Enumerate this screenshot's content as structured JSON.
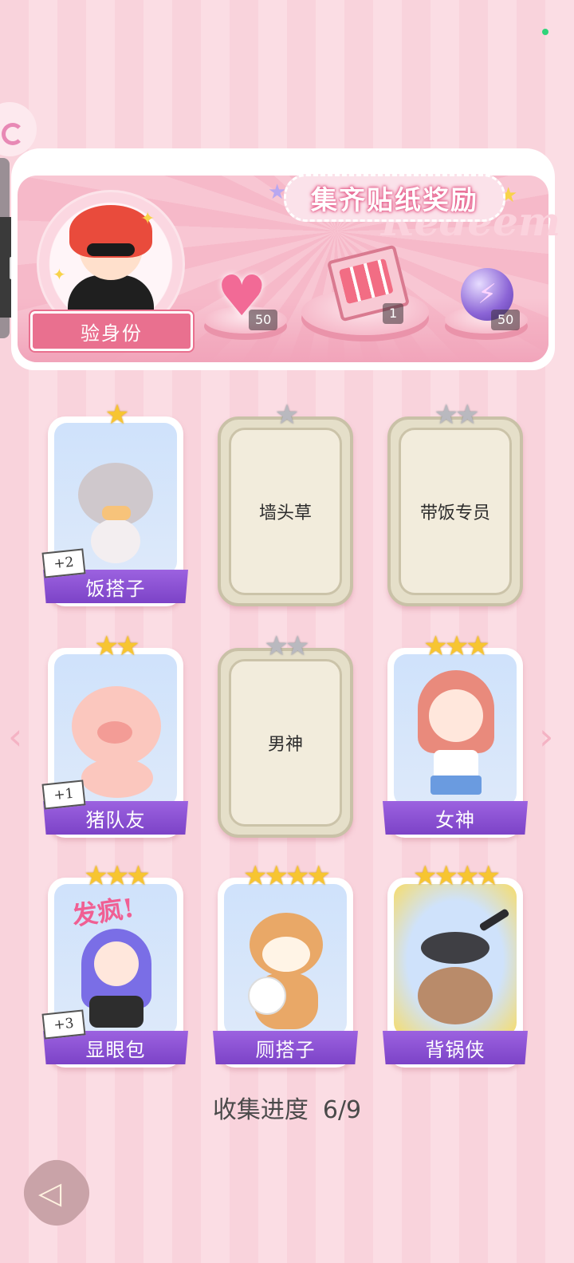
{
  "banner": {
    "title": "集齐贴纸奖励",
    "deco_text": "Redeem",
    "verify_label": "验身份",
    "rewards": [
      {
        "icon": "heart-gem-icon",
        "count": "50"
      },
      {
        "icon": "gift-box-icon",
        "count": "1"
      },
      {
        "icon": "energy-orb-icon",
        "count": "50"
      }
    ]
  },
  "cards": [
    {
      "label": "饭搭子",
      "stars": 1,
      "star_color": "gold",
      "locked": false,
      "plus": "+2",
      "art": "cat-with-cake"
    },
    {
      "label": "墙头草",
      "stars": 1,
      "star_color": "silver",
      "locked": true,
      "plus": "",
      "art": ""
    },
    {
      "label": "带饭专员",
      "stars": 2,
      "star_color": "silver",
      "locked": true,
      "plus": "",
      "art": ""
    },
    {
      "label": "猪队友",
      "stars": 2,
      "star_color": "gold",
      "locked": false,
      "plus": "+1",
      "art": "winking-pig"
    },
    {
      "label": "男神",
      "stars": 2,
      "star_color": "silver",
      "locked": true,
      "plus": "",
      "art": ""
    },
    {
      "label": "女神",
      "stars": 3,
      "star_color": "gold",
      "locked": false,
      "plus": "",
      "art": "schoolgirl"
    },
    {
      "label": "显眼包",
      "stars": 3,
      "star_color": "gold",
      "locked": false,
      "plus": "+3",
      "art": "crazy-girl",
      "art_text": "发疯!"
    },
    {
      "label": "厕搭子",
      "stars": 4,
      "star_color": "gold",
      "locked": false,
      "plus": "",
      "art": "shiba-toilet-paper"
    },
    {
      "label": "背锅侠",
      "stars": 4,
      "star_color": "gold",
      "locked": false,
      "plus": "",
      "art": "capybara-with-pan"
    }
  ],
  "progress": {
    "label": "收集进度",
    "value": "6/9"
  },
  "nav": {
    "prev": "‹",
    "next": "›"
  },
  "colors": {
    "label_purple": "#8a4fd4",
    "banner_pink": "#f6b9c9",
    "gold_star": "#f7c531",
    "silver_star": "#b9b9bf"
  }
}
